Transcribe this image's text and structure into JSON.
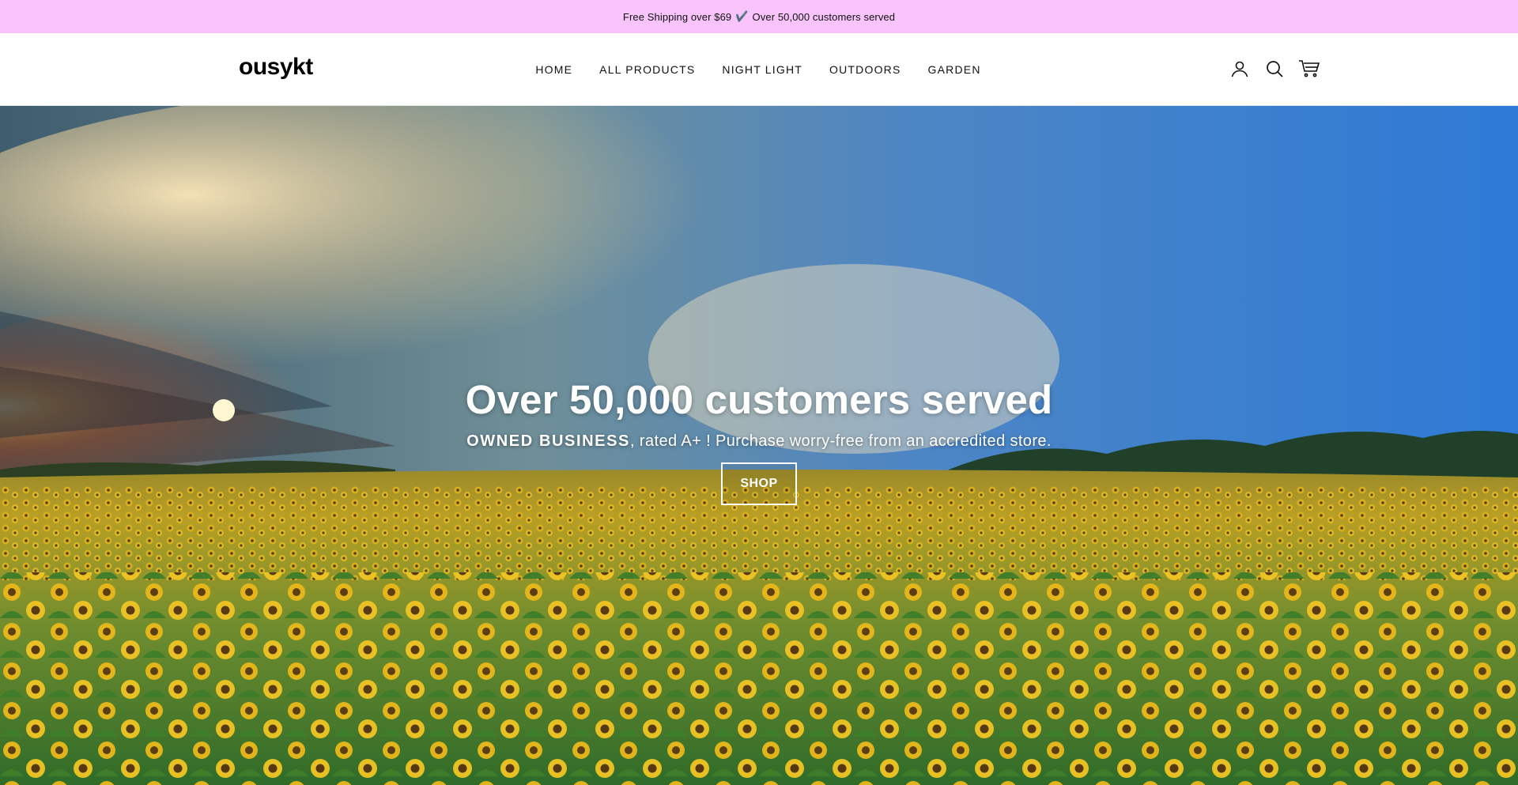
{
  "announcement": {
    "left": "Free Shipping over $69",
    "check": "✔️",
    "right": "Over 50,000 customers served"
  },
  "header": {
    "logo": "ousykt",
    "nav": [
      {
        "label": "HOME"
      },
      {
        "label": "ALL PRODUCTS"
      },
      {
        "label": "NIGHT LIGHT"
      },
      {
        "label": "OUTDOORS"
      },
      {
        "label": "GARDEN"
      }
    ],
    "icons": [
      "account-icon",
      "search-icon",
      "cart-icon"
    ]
  },
  "hero": {
    "title": "Over 50,000 customers served",
    "subtitle_strong": "OWNED BUSINESS",
    "subtitle_rest": ", rated A+ ! Purchase worry-free from an accredited store.",
    "button_label": "SHOP"
  },
  "colors": {
    "announcement_bg": "#f9c4fb",
    "header_bg": "#ffffff",
    "text": "#111111"
  }
}
